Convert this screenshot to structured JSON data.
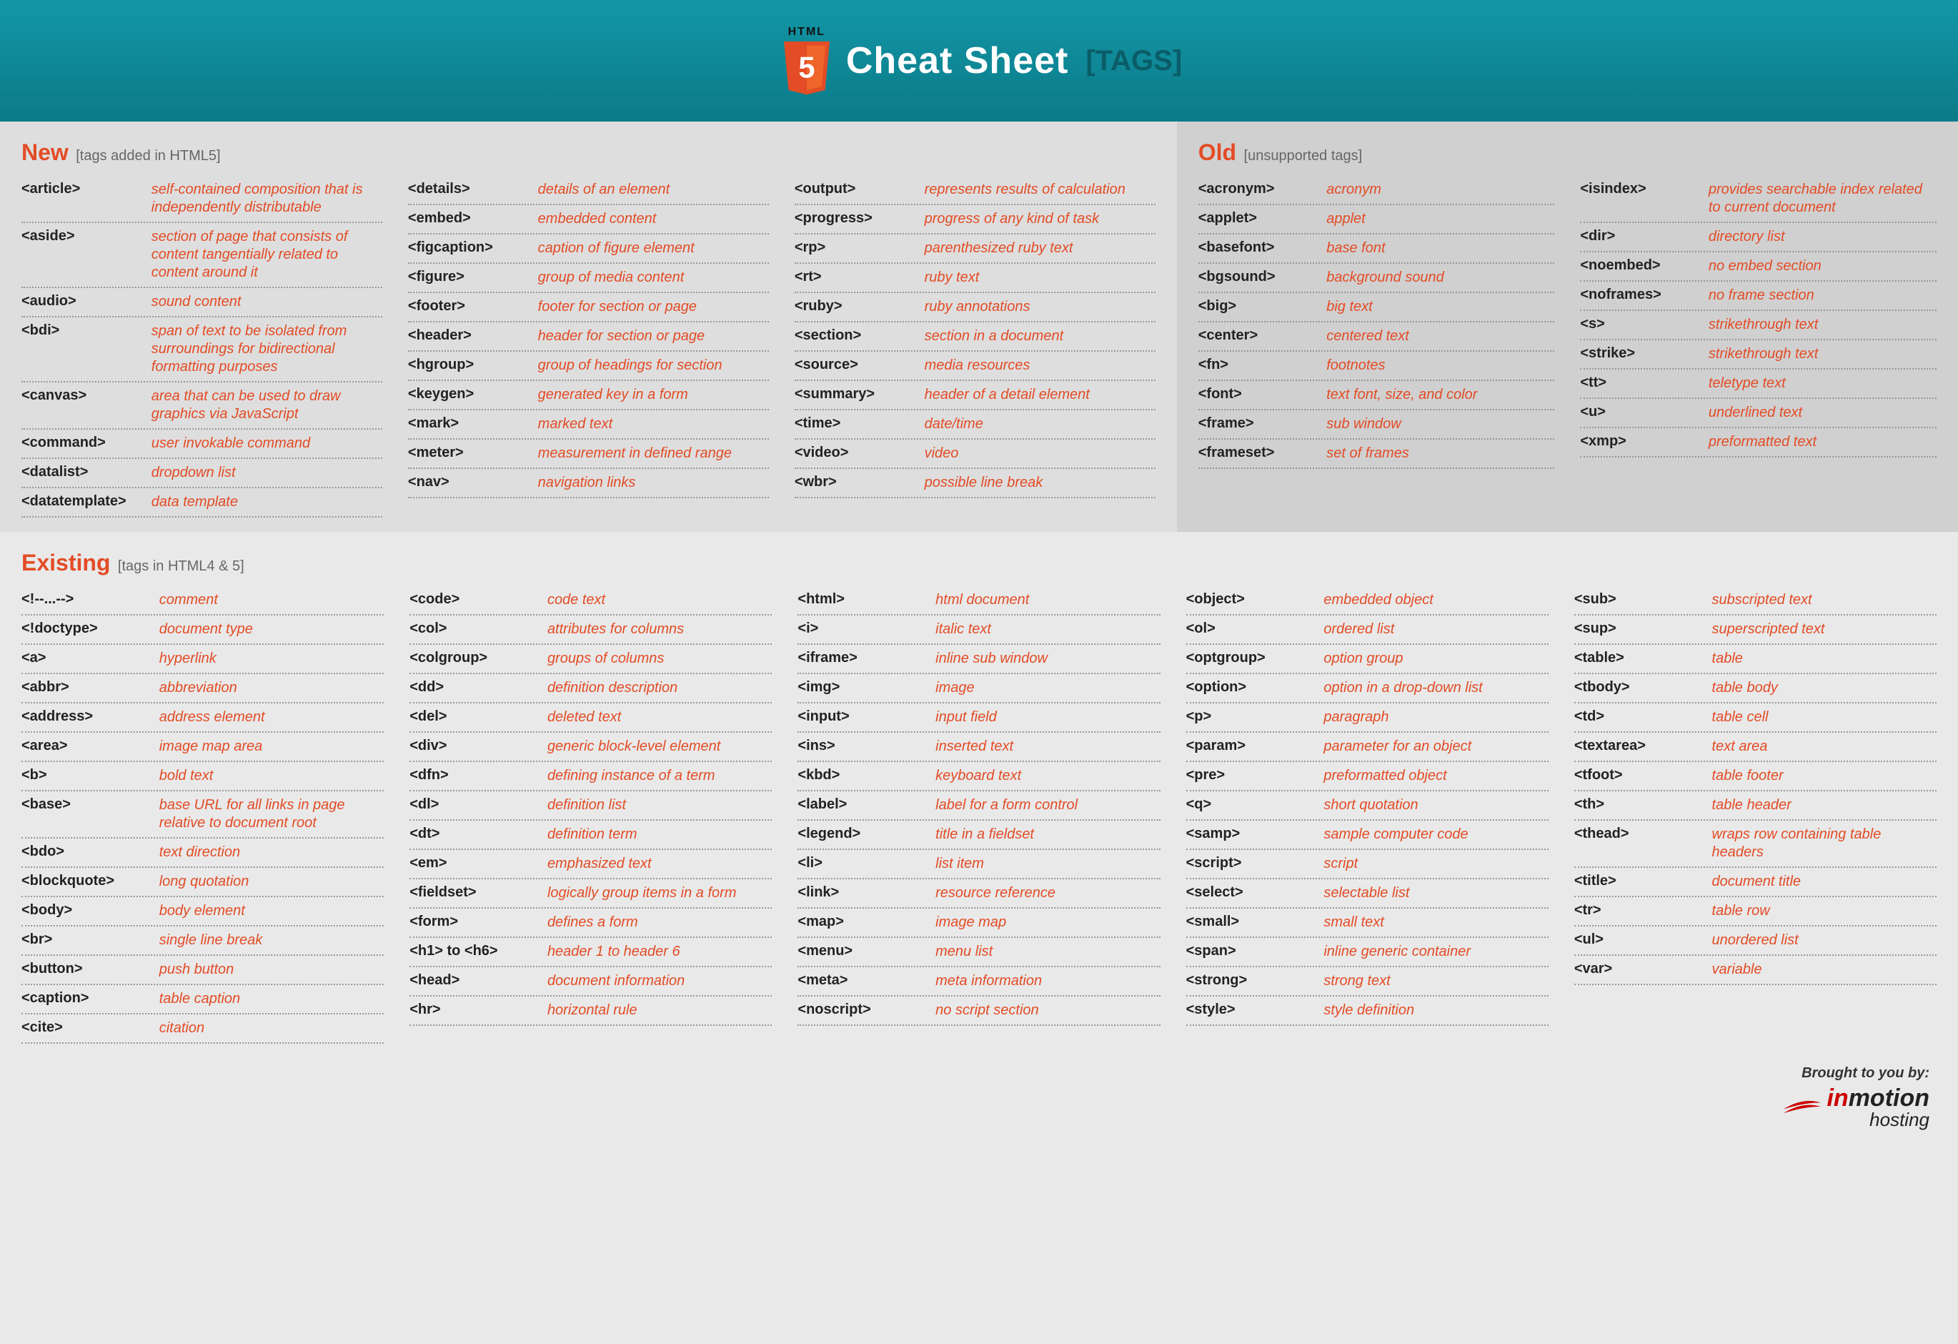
{
  "header": {
    "logo_top": "HTML",
    "logo_num": "5",
    "title": "Cheat Sheet",
    "bracket": "[TAGS]"
  },
  "sections": {
    "new": {
      "title": "New",
      "sub": "[tags added in HTML5]",
      "cols": [
        [
          {
            "tag": "<article>",
            "desc": "self-contained composition that is independently distributable"
          },
          {
            "tag": "<aside>",
            "desc": "section of page that consists of content tangentially related to content around it"
          },
          {
            "tag": "<audio>",
            "desc": "sound content"
          },
          {
            "tag": "<bdi>",
            "desc": "span of text to be isolated from surroundings for bidirectional formatting purposes"
          },
          {
            "tag": "<canvas>",
            "desc": "area that can be used to draw graphics via JavaScript"
          },
          {
            "tag": "<command>",
            "desc": "user invokable command"
          },
          {
            "tag": "<datalist>",
            "desc": "dropdown list"
          },
          {
            "tag": "<datatemplate>",
            "desc": "data template"
          }
        ],
        [
          {
            "tag": "<details>",
            "desc": "details of an element"
          },
          {
            "tag": "<embed>",
            "desc": "embedded content"
          },
          {
            "tag": "<figcaption>",
            "desc": "caption of figure element"
          },
          {
            "tag": "<figure>",
            "desc": "group of media content"
          },
          {
            "tag": "<footer>",
            "desc": "footer for section or page"
          },
          {
            "tag": "<header>",
            "desc": "header for section or page"
          },
          {
            "tag": "<hgroup>",
            "desc": "group of headings for section"
          },
          {
            "tag": "<keygen>",
            "desc": "generated key in a form"
          },
          {
            "tag": "<mark>",
            "desc": "marked text"
          },
          {
            "tag": "<meter>",
            "desc": "measurement in defined range"
          },
          {
            "tag": "<nav>",
            "desc": "navigation links"
          }
        ],
        [
          {
            "tag": "<output>",
            "desc": "represents results of calculation"
          },
          {
            "tag": "<progress>",
            "desc": "progress of any kind of task"
          },
          {
            "tag": "<rp>",
            "desc": "parenthesized ruby text"
          },
          {
            "tag": "<rt>",
            "desc": "ruby text"
          },
          {
            "tag": "<ruby>",
            "desc": "ruby annotations"
          },
          {
            "tag": "<section>",
            "desc": "section in a document"
          },
          {
            "tag": "<source>",
            "desc": "media resources"
          },
          {
            "tag": "<summary>",
            "desc": "header of a detail element"
          },
          {
            "tag": "<time>",
            "desc": "date/time"
          },
          {
            "tag": "<video>",
            "desc": "video"
          },
          {
            "tag": "<wbr>",
            "desc": "possible line break"
          }
        ]
      ]
    },
    "old": {
      "title": "Old",
      "sub": "[unsupported tags]",
      "cols": [
        [
          {
            "tag": "<acronym>",
            "desc": "acronym"
          },
          {
            "tag": "<applet>",
            "desc": "applet"
          },
          {
            "tag": "<basefont>",
            "desc": "base font"
          },
          {
            "tag": "<bgsound>",
            "desc": "background sound"
          },
          {
            "tag": "<big>",
            "desc": "big text"
          },
          {
            "tag": "<center>",
            "desc": "centered text"
          },
          {
            "tag": "<fn>",
            "desc": "footnotes"
          },
          {
            "tag": "<font>",
            "desc": "text font, size, and color"
          },
          {
            "tag": "<frame>",
            "desc": "sub window"
          },
          {
            "tag": "<frameset>",
            "desc": "set of frames"
          }
        ],
        [
          {
            "tag": "<isindex>",
            "desc": "provides searchable index related to current document"
          },
          {
            "tag": "<dir>",
            "desc": "directory list"
          },
          {
            "tag": "<noembed>",
            "desc": "no embed section"
          },
          {
            "tag": "<noframes>",
            "desc": "no frame section"
          },
          {
            "tag": "<s>",
            "desc": "strikethrough text"
          },
          {
            "tag": "<strike>",
            "desc": "strikethrough text"
          },
          {
            "tag": "<tt>",
            "desc": "teletype text"
          },
          {
            "tag": "<u>",
            "desc": "underlined text"
          },
          {
            "tag": "<xmp>",
            "desc": "preformatted text"
          }
        ]
      ]
    },
    "existing": {
      "title": "Existing",
      "sub": "[tags in HTML4 & 5]",
      "cols": [
        [
          {
            "tag": "<!--...-->",
            "desc": "comment"
          },
          {
            "tag": "<!doctype>",
            "desc": "document type"
          },
          {
            "tag": "<a>",
            "desc": "hyperlink"
          },
          {
            "tag": "<abbr>",
            "desc": "abbreviation"
          },
          {
            "tag": "<address>",
            "desc": "address element"
          },
          {
            "tag": "<area>",
            "desc": "image map area"
          },
          {
            "tag": "<b>",
            "desc": "bold text"
          },
          {
            "tag": "<base>",
            "desc": "base URL for all links in page relative to document root"
          },
          {
            "tag": "<bdo>",
            "desc": "text direction"
          },
          {
            "tag": "<blockquote>",
            "desc": "long quotation"
          },
          {
            "tag": "<body>",
            "desc": "body element"
          },
          {
            "tag": "<br>",
            "desc": "single line break"
          },
          {
            "tag": "<button>",
            "desc": "push button"
          },
          {
            "tag": "<caption>",
            "desc": "table caption"
          },
          {
            "tag": "<cite>",
            "desc": "citation"
          }
        ],
        [
          {
            "tag": "<code>",
            "desc": "code text"
          },
          {
            "tag": "<col>",
            "desc": "attributes for columns"
          },
          {
            "tag": "<colgroup>",
            "desc": "groups of columns"
          },
          {
            "tag": "<dd>",
            "desc": "definition description"
          },
          {
            "tag": "<del>",
            "desc": "deleted text"
          },
          {
            "tag": "<div>",
            "desc": "generic block-level element"
          },
          {
            "tag": "<dfn>",
            "desc": "defining instance of a term"
          },
          {
            "tag": "<dl>",
            "desc": "definition list"
          },
          {
            "tag": "<dt>",
            "desc": "definition term"
          },
          {
            "tag": "<em>",
            "desc": "emphasized text"
          },
          {
            "tag": "<fieldset>",
            "desc": "logically group items in a form"
          },
          {
            "tag": "<form>",
            "desc": "defines a form"
          },
          {
            "tag": "<h1> to <h6>",
            "desc": "header 1 to header 6"
          },
          {
            "tag": "<head>",
            "desc": "document information"
          },
          {
            "tag": "<hr>",
            "desc": "horizontal rule"
          }
        ],
        [
          {
            "tag": "<html>",
            "desc": "html document"
          },
          {
            "tag": "<i>",
            "desc": "italic text"
          },
          {
            "tag": "<iframe>",
            "desc": "inline sub window"
          },
          {
            "tag": "<img>",
            "desc": "image"
          },
          {
            "tag": "<input>",
            "desc": "input field"
          },
          {
            "tag": "<ins>",
            "desc": "inserted text"
          },
          {
            "tag": "<kbd>",
            "desc": "keyboard text"
          },
          {
            "tag": "<label>",
            "desc": "label for a form control"
          },
          {
            "tag": "<legend>",
            "desc": "title in a fieldset"
          },
          {
            "tag": "<li>",
            "desc": "list item"
          },
          {
            "tag": "<link>",
            "desc": "resource reference"
          },
          {
            "tag": "<map>",
            "desc": "image map"
          },
          {
            "tag": "<menu>",
            "desc": "menu list"
          },
          {
            "tag": "<meta>",
            "desc": "meta information"
          },
          {
            "tag": "<noscript>",
            "desc": "no script section"
          }
        ],
        [
          {
            "tag": "<object>",
            "desc": "embedded object"
          },
          {
            "tag": "<ol>",
            "desc": "ordered list"
          },
          {
            "tag": "<optgroup>",
            "desc": "option group"
          },
          {
            "tag": "<option>",
            "desc": "option in a drop-down list"
          },
          {
            "tag": "<p>",
            "desc": "paragraph"
          },
          {
            "tag": "<param>",
            "desc": "parameter for an object"
          },
          {
            "tag": "<pre>",
            "desc": "preformatted object"
          },
          {
            "tag": "<q>",
            "desc": "short quotation"
          },
          {
            "tag": "<samp>",
            "desc": "sample computer code"
          },
          {
            "tag": "<script>",
            "desc": "script"
          },
          {
            "tag": "<select>",
            "desc": "selectable list"
          },
          {
            "tag": "<small>",
            "desc": "small text"
          },
          {
            "tag": "<span>",
            "desc": "inline generic container"
          },
          {
            "tag": "<strong>",
            "desc": "strong text"
          },
          {
            "tag": "<style>",
            "desc": "style definition"
          }
        ],
        [
          {
            "tag": "<sub>",
            "desc": "subscripted text"
          },
          {
            "tag": "<sup>",
            "desc": "superscripted text"
          },
          {
            "tag": "<table>",
            "desc": "table"
          },
          {
            "tag": "<tbody>",
            "desc": "table body"
          },
          {
            "tag": "<td>",
            "desc": "table cell"
          },
          {
            "tag": "<textarea>",
            "desc": "text area"
          },
          {
            "tag": "<tfoot>",
            "desc": "table footer"
          },
          {
            "tag": "<th>",
            "desc": "table header"
          },
          {
            "tag": "<thead>",
            "desc": "wraps row containing table headers"
          },
          {
            "tag": "<title>",
            "desc": "document title"
          },
          {
            "tag": "<tr>",
            "desc": "table row"
          },
          {
            "tag": "<ul>",
            "desc": "unordered list"
          },
          {
            "tag": "<var>",
            "desc": "variable"
          }
        ]
      ]
    }
  },
  "footer": {
    "brought": "Brought to you by:",
    "brand_pre": "in",
    "brand_post": "motion",
    "brand_sub": "hosting"
  }
}
